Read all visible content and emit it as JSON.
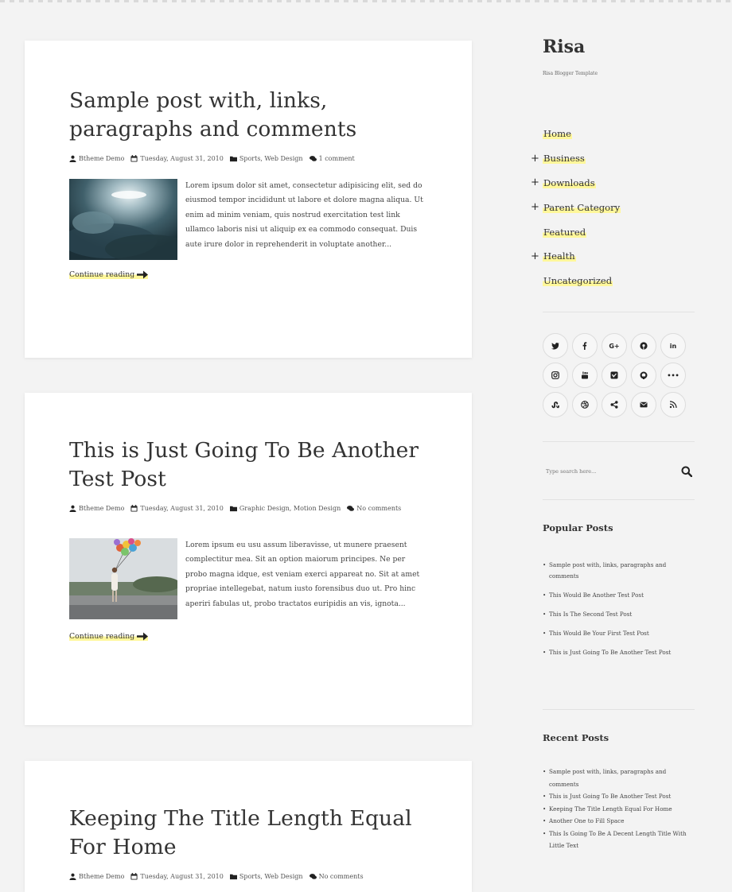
{
  "posts": [
    {
      "title": "Sample post with, links, paragraphs and comments",
      "author": "Btheme Demo",
      "date": "Tuesday, August 31, 2010",
      "labels": "Sports, Web Design",
      "comments": "1 comment",
      "excerpt": "Lorem ipsum dolor sit amet, consectetur adipisicing elit, sed do eiusmod tempor incididunt ut labore et dolore magna aliqua. Ut enim ad minim veniam, quis nostrud exercitation test link ullamco laboris nisi ut aliquip ex ea commodo consequat. Duis aute irure dolor in reprehenderit in voluptate another...",
      "more": "Continue reading"
    },
    {
      "title": "This is Just Going To Be Another Test Post",
      "author": "Btheme Demo",
      "date": "Tuesday, August 31, 2010",
      "labels": "Graphic Design, Motion Design",
      "comments": "No comments",
      "excerpt": "Lorem ipsum eu usu assum liberavisse, ut munere praesent complectitur mea. Sit an option maiorum principes. Ne per probo magna idque, est veniam exerci appareat no. Sit at amet propriae intellegebat, natum iusto forensibus duo ut. Pro hinc aperiri fabulas ut, probo tractatos euripidis an vis, ignota...",
      "more": "Continue reading"
    },
    {
      "title": "Keeping The Title Length Equal For Home",
      "author": "Btheme Demo",
      "date": "Tuesday, August 31, 2010",
      "labels": "Sports, Web Design",
      "comments": "No comments"
    }
  ],
  "sidebar": {
    "blog_title": "Risa",
    "blog_description": "Risa Blogger Template",
    "menu": [
      {
        "label": "Home",
        "has_children": false
      },
      {
        "label": "Business",
        "has_children": true
      },
      {
        "label": "Downloads",
        "has_children": true
      },
      {
        "label": "Parent Category",
        "has_children": true
      },
      {
        "label": "Featured",
        "has_children": false
      },
      {
        "label": "Health",
        "has_children": true
      },
      {
        "label": "Uncategorized",
        "has_children": false
      }
    ],
    "social": {
      "googleplus": "G+",
      "linkedin": "in",
      "flickr": "•••"
    },
    "search_placeholder": "Type search here...",
    "popular_title": "Popular Posts",
    "popular_posts": [
      "Sample post with, links, paragraphs and comments",
      "This Would Be Another Test Post",
      "This Is The Second Test Post",
      "This Would Be Your First Test Post",
      "This is Just Going To Be Another Test Post"
    ],
    "recent_title": "Recent Posts",
    "recent_posts": [
      "Sample post with, links, paragraphs and comments",
      "This is Just Going To Be Another Test Post",
      "Keeping The Title Length Equal For Home",
      "Another One to Fill Space",
      "This Is Going To Be A Decent Length Title With Little Text"
    ]
  },
  "colors": {
    "highlight": "#fff79a",
    "page_bg": "#f3f3f3",
    "card_bg": "#ffffff"
  },
  "icons": {
    "author": "user-icon",
    "date": "calendar-icon",
    "labels": "folder-icon",
    "comments": "comments-icon",
    "more": "arrow-right-icon",
    "search": "search-icon"
  }
}
